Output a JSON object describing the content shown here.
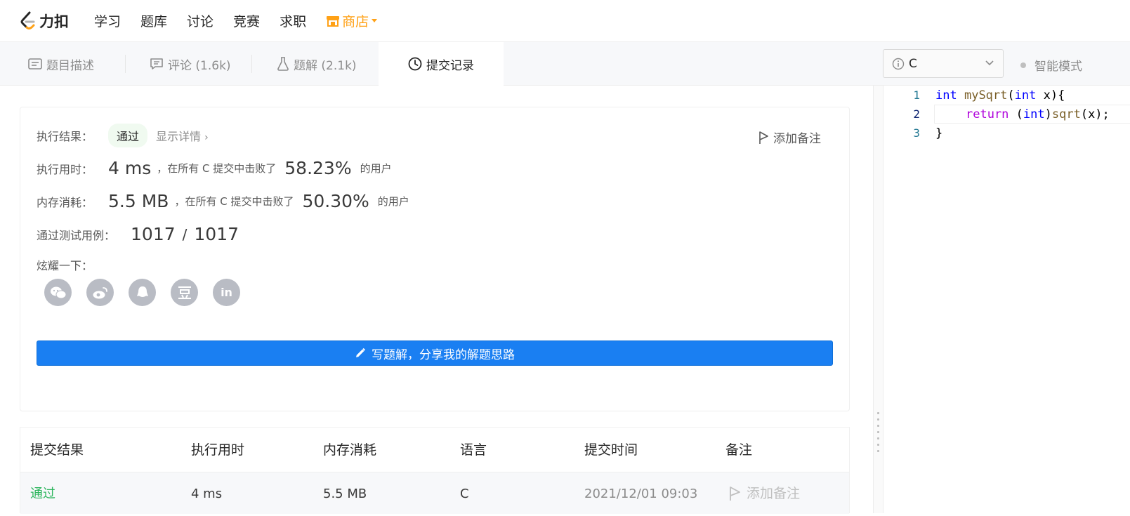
{
  "topnav": {
    "logo_text": "力扣",
    "items": [
      "学习",
      "题库",
      "讨论",
      "竞赛",
      "求职"
    ],
    "store_label": "商店",
    "accent": "#ffa116"
  },
  "tabs": {
    "description": "题目描述",
    "comments": "评论 (1.6k)",
    "solutions": "题解 (2.1k)",
    "submissions": "提交记录"
  },
  "editor_toolbar": {
    "language": "C",
    "smart_mode": "智能模式"
  },
  "result": {
    "status_label": "执行结果：",
    "status": "通过",
    "show_detail": "显示详情",
    "add_note": "添加备注",
    "runtime_label": "执行用时：",
    "runtime": "4 ms",
    "runtime_mid": "，在所有 C 提交中击败了",
    "runtime_pct": "58.23%",
    "users_suffix": "的用户",
    "memory_label": "内存消耗：",
    "memory": "5.5 MB",
    "memory_mid": "，在所有 C 提交中击败了",
    "memory_pct": "50.30%",
    "cases_label": "通过测试用例：",
    "cases_passed": "1017",
    "cases_sep": "/",
    "cases_total": "1017",
    "share_label": "炫耀一下：",
    "share_icons": [
      "wechat-icon",
      "weibo-icon",
      "qq-icon",
      "douban-icon",
      "linkedin-icon"
    ],
    "linkedin_text": "in",
    "write_solution": "写题解，分享我的解题思路"
  },
  "table": {
    "headers": [
      "提交结果",
      "执行用时",
      "内存消耗",
      "语言",
      "提交时间",
      "备注"
    ],
    "rows": [
      {
        "result": "通过",
        "runtime": "4 ms",
        "memory": "5.5 MB",
        "language": "C",
        "time": "2021/12/01 09:03",
        "note": "添加备注"
      }
    ]
  },
  "code": {
    "line_numbers": [
      "1",
      "2",
      "3"
    ],
    "l1_kw": "int",
    "l1_fn": "mySqrt",
    "l1_open": "(",
    "l1_kw2": "int",
    "l1_rest": " x){",
    "l2_ret": "return",
    "l2_open": " (",
    "l2_kw": "int",
    "l2_close": ")",
    "l2_fn": "sqrt",
    "l2_rest": "(x);",
    "l3": "}"
  }
}
